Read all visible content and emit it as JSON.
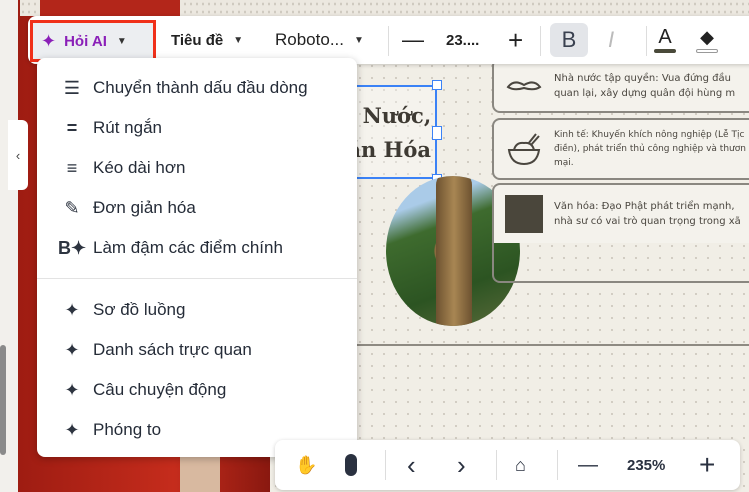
{
  "toolbar": {
    "ai_label": "Hỏi AI",
    "style_label": "Tiêu đề",
    "font_label": "Roboto...",
    "font_size": "23....",
    "bold": "B",
    "italic": "I",
    "text_color_glyph": "A"
  },
  "menu": {
    "items": [
      {
        "label": "Chuyển thành dấu đầu dòng",
        "icon": "bullet-list-icon"
      },
      {
        "label": "Rút ngắn",
        "icon": "shorten-icon"
      },
      {
        "label": "Kéo dài hơn",
        "icon": "lengthen-icon"
      },
      {
        "label": "Đơn giản hóa",
        "icon": "pencil-icon"
      },
      {
        "label": "Làm đậm các điểm chính",
        "icon": "bold-sparkle-icon"
      },
      {
        "label": "Sơ đồ luồng",
        "icon": "sparkle-icon"
      },
      {
        "label": "Danh sách trực quan",
        "icon": "sparkle-icon"
      },
      {
        "label": "Câu chuyện động",
        "icon": "sparkle-icon"
      },
      {
        "label": "Phóng to",
        "icon": "sparkle-icon"
      }
    ]
  },
  "slide": {
    "title_line1": "n Nước,",
    "title_line2": "ăn Hóa",
    "cards": [
      {
        "line1": "Nhà nước tập quyền: Vua đứng đầu",
        "line2": "quan lại, xây dựng quân đội hùng m",
        "line3": ""
      },
      {
        "line1": "Kinh tế: Khuyến khích nông nghiệp (Lễ Tịc",
        "line2": "điền), phát triển thủ công nghiệp và thươn",
        "line3": "mại."
      },
      {
        "line1": "Văn hóa: Đạo Phật phát triển mạnh,",
        "line2": "nhà sư có vai trò quan trọng trong xã",
        "line3": ""
      }
    ]
  },
  "bottom": {
    "zoom": "235%"
  },
  "colors": {
    "ai_accent": "#8a1fb8",
    "highlight_border": "#f0301a",
    "selection": "#3b82f6"
  }
}
